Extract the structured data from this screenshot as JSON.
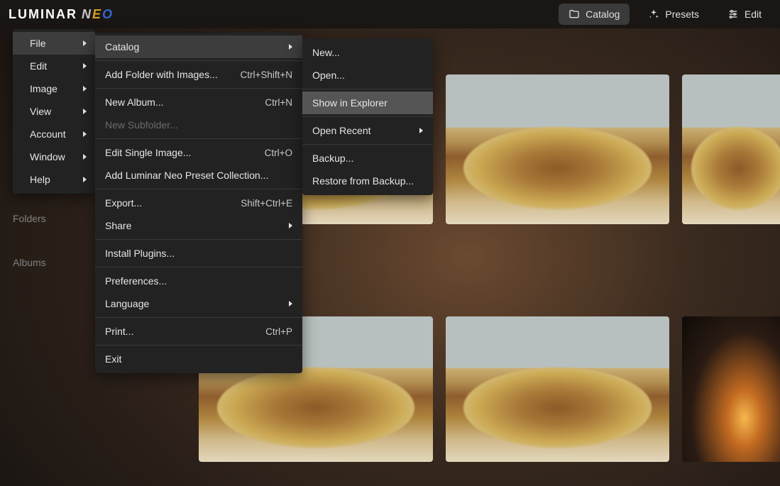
{
  "logo": {
    "brand": "LUMINAR",
    "suffix_n": "N",
    "suffix_e": "E",
    "suffix_o": "O"
  },
  "topbar": {
    "catalog": "Catalog",
    "presets": "Presets",
    "edit": "Edit"
  },
  "sidebar": {
    "folders": "Folders",
    "albums": "Albums"
  },
  "main_menu": {
    "file": "File",
    "edit": "Edit",
    "image": "Image",
    "view": "View",
    "account": "Account",
    "window": "Window",
    "help": "Help"
  },
  "file_menu": {
    "catalog": "Catalog",
    "add_folder": {
      "label": "Add Folder with Images...",
      "shortcut": "Ctrl+Shift+N"
    },
    "new_album": {
      "label": "New Album...",
      "shortcut": "Ctrl+N"
    },
    "new_subfolder": "New Subfolder...",
    "edit_single": {
      "label": "Edit Single Image...",
      "shortcut": "Ctrl+O"
    },
    "add_preset": "Add Luminar Neo Preset Collection...",
    "export": {
      "label": "Export...",
      "shortcut": "Shift+Ctrl+E"
    },
    "share": "Share",
    "install_plugins": "Install Plugins...",
    "preferences": "Preferences...",
    "language": "Language",
    "print": {
      "label": "Print...",
      "shortcut": "Ctrl+P"
    },
    "exit": "Exit"
  },
  "catalog_menu": {
    "new": "New...",
    "open": "Open...",
    "show_in_explorer": "Show in Explorer",
    "open_recent": "Open Recent",
    "backup": "Backup...",
    "restore": "Restore from Backup..."
  }
}
